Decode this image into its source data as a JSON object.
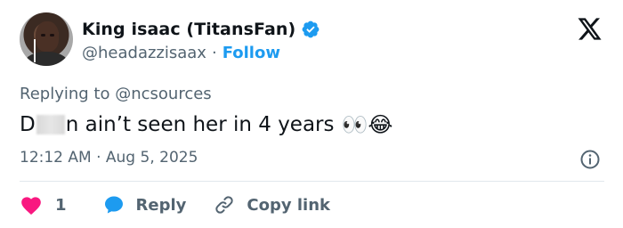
{
  "author": {
    "display_name": "King isaac (TitansFan)",
    "handle": "@headazzisaax",
    "separator": "·",
    "follow_label": "Follow",
    "verified": true
  },
  "tweet": {
    "replying_prefix": "Replying to",
    "replying_to": "@ncsources",
    "text_start": "D",
    "text_rest": "n ain’t seen her in 4 years",
    "emojis": "👀😂",
    "timestamp": "12:12 AM · Aug 5, 2025"
  },
  "actions": {
    "like_count": "1",
    "reply_label": "Reply",
    "copy_link_label": "Copy link"
  },
  "colors": {
    "accent": "#1d9bf0",
    "like": "#f91880",
    "secondary_text": "#536471",
    "primary_text": "#0f1419"
  },
  "icons": {
    "verified": "verified-badge-icon",
    "brand": "x-logo-icon",
    "info": "info-icon",
    "like": "heart-icon",
    "reply": "speech-bubble-icon",
    "copy": "link-icon"
  }
}
